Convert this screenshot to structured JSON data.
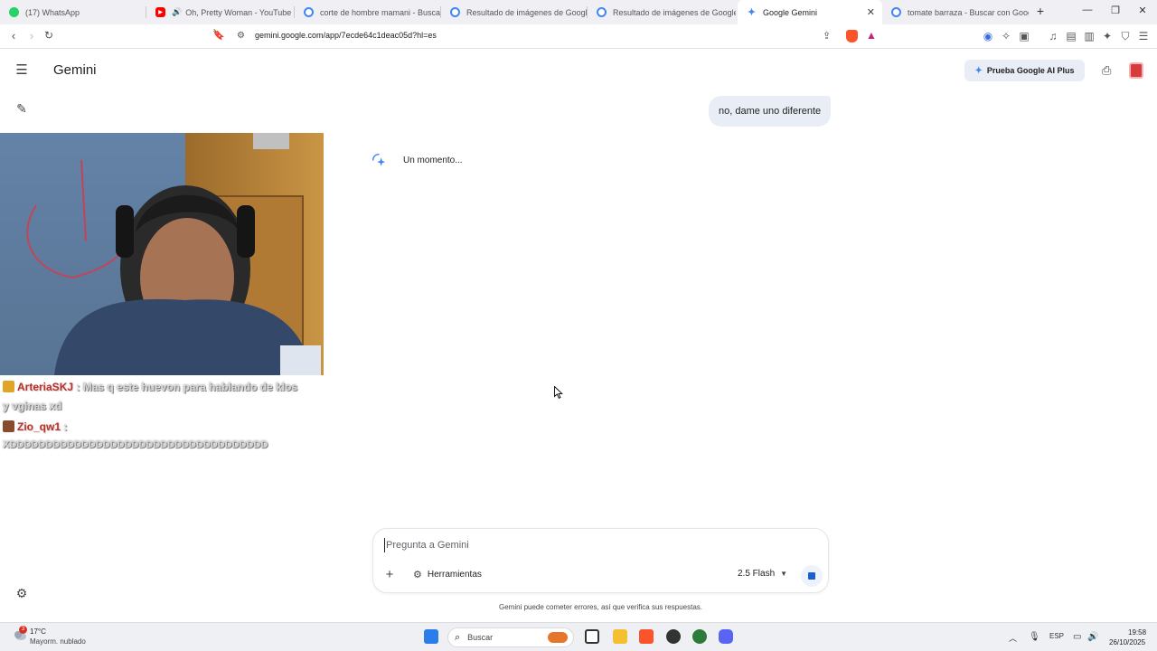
{
  "browser": {
    "tabs": [
      {
        "label": "(17) WhatsApp",
        "icon": "whatsapp-icon",
        "color": "#25d366"
      },
      {
        "label": "Oh, Pretty Woman - YouTube",
        "icon": "youtube-icon",
        "color": "#ff0000"
      },
      {
        "label": "corte de hombre mamani - Buscar c",
        "icon": "google-icon",
        "color": "#4285f4"
      },
      {
        "label": "Resultado de imágenes de Google",
        "icon": "google-icon",
        "color": "#4285f4"
      },
      {
        "label": "Resultado de imágenes de Google",
        "icon": "google-icon",
        "color": "#4285f4"
      },
      {
        "label": "Google Gemini",
        "icon": "gemini-icon",
        "color": "#4285f4"
      },
      {
        "label": "tomate barraza - Buscar con Google",
        "icon": "google-icon",
        "color": "#4285f4"
      }
    ],
    "new_tab_label": "+",
    "url": "gemini.google.com/app/7ecde64c1deac05d?hl=es"
  },
  "app": {
    "brand": "Gemini",
    "upgrade_label": "Prueba Google AI Plus",
    "accent": "#4285f4"
  },
  "conversation": {
    "user_message": "no, dame uno diferente",
    "loading_text": "Un momento..."
  },
  "stream_overlay": {
    "chat": [
      {
        "user": "ArteriaSKJ",
        "text": ": Mas q este huevon para hablando de klos",
        "continuation": "y vginas xd",
        "badge_color": "#e0a526"
      },
      {
        "user": "Zio_qw1",
        "text": ":",
        "continuation": "XDDDDDDDDDDDDDDDDDDDDDDDDDDDDDDDDDDDD",
        "badge_color": "#8a4b2a"
      }
    ]
  },
  "composer": {
    "placeholder": "Pregunta a Gemini",
    "add_label": "+",
    "tools_label": "Herramientas",
    "model_label": "2.5 Flash",
    "disclaimer": "Gemini puede cometer errores, así que verifica sus respuestas."
  },
  "taskbar": {
    "weather_temp": "17°C",
    "weather_desc": "Mayorm. nublado",
    "weather_badge": "3",
    "search_label": "Buscar",
    "language": "ESP",
    "time": "19:58",
    "date": "26/10/2025"
  }
}
